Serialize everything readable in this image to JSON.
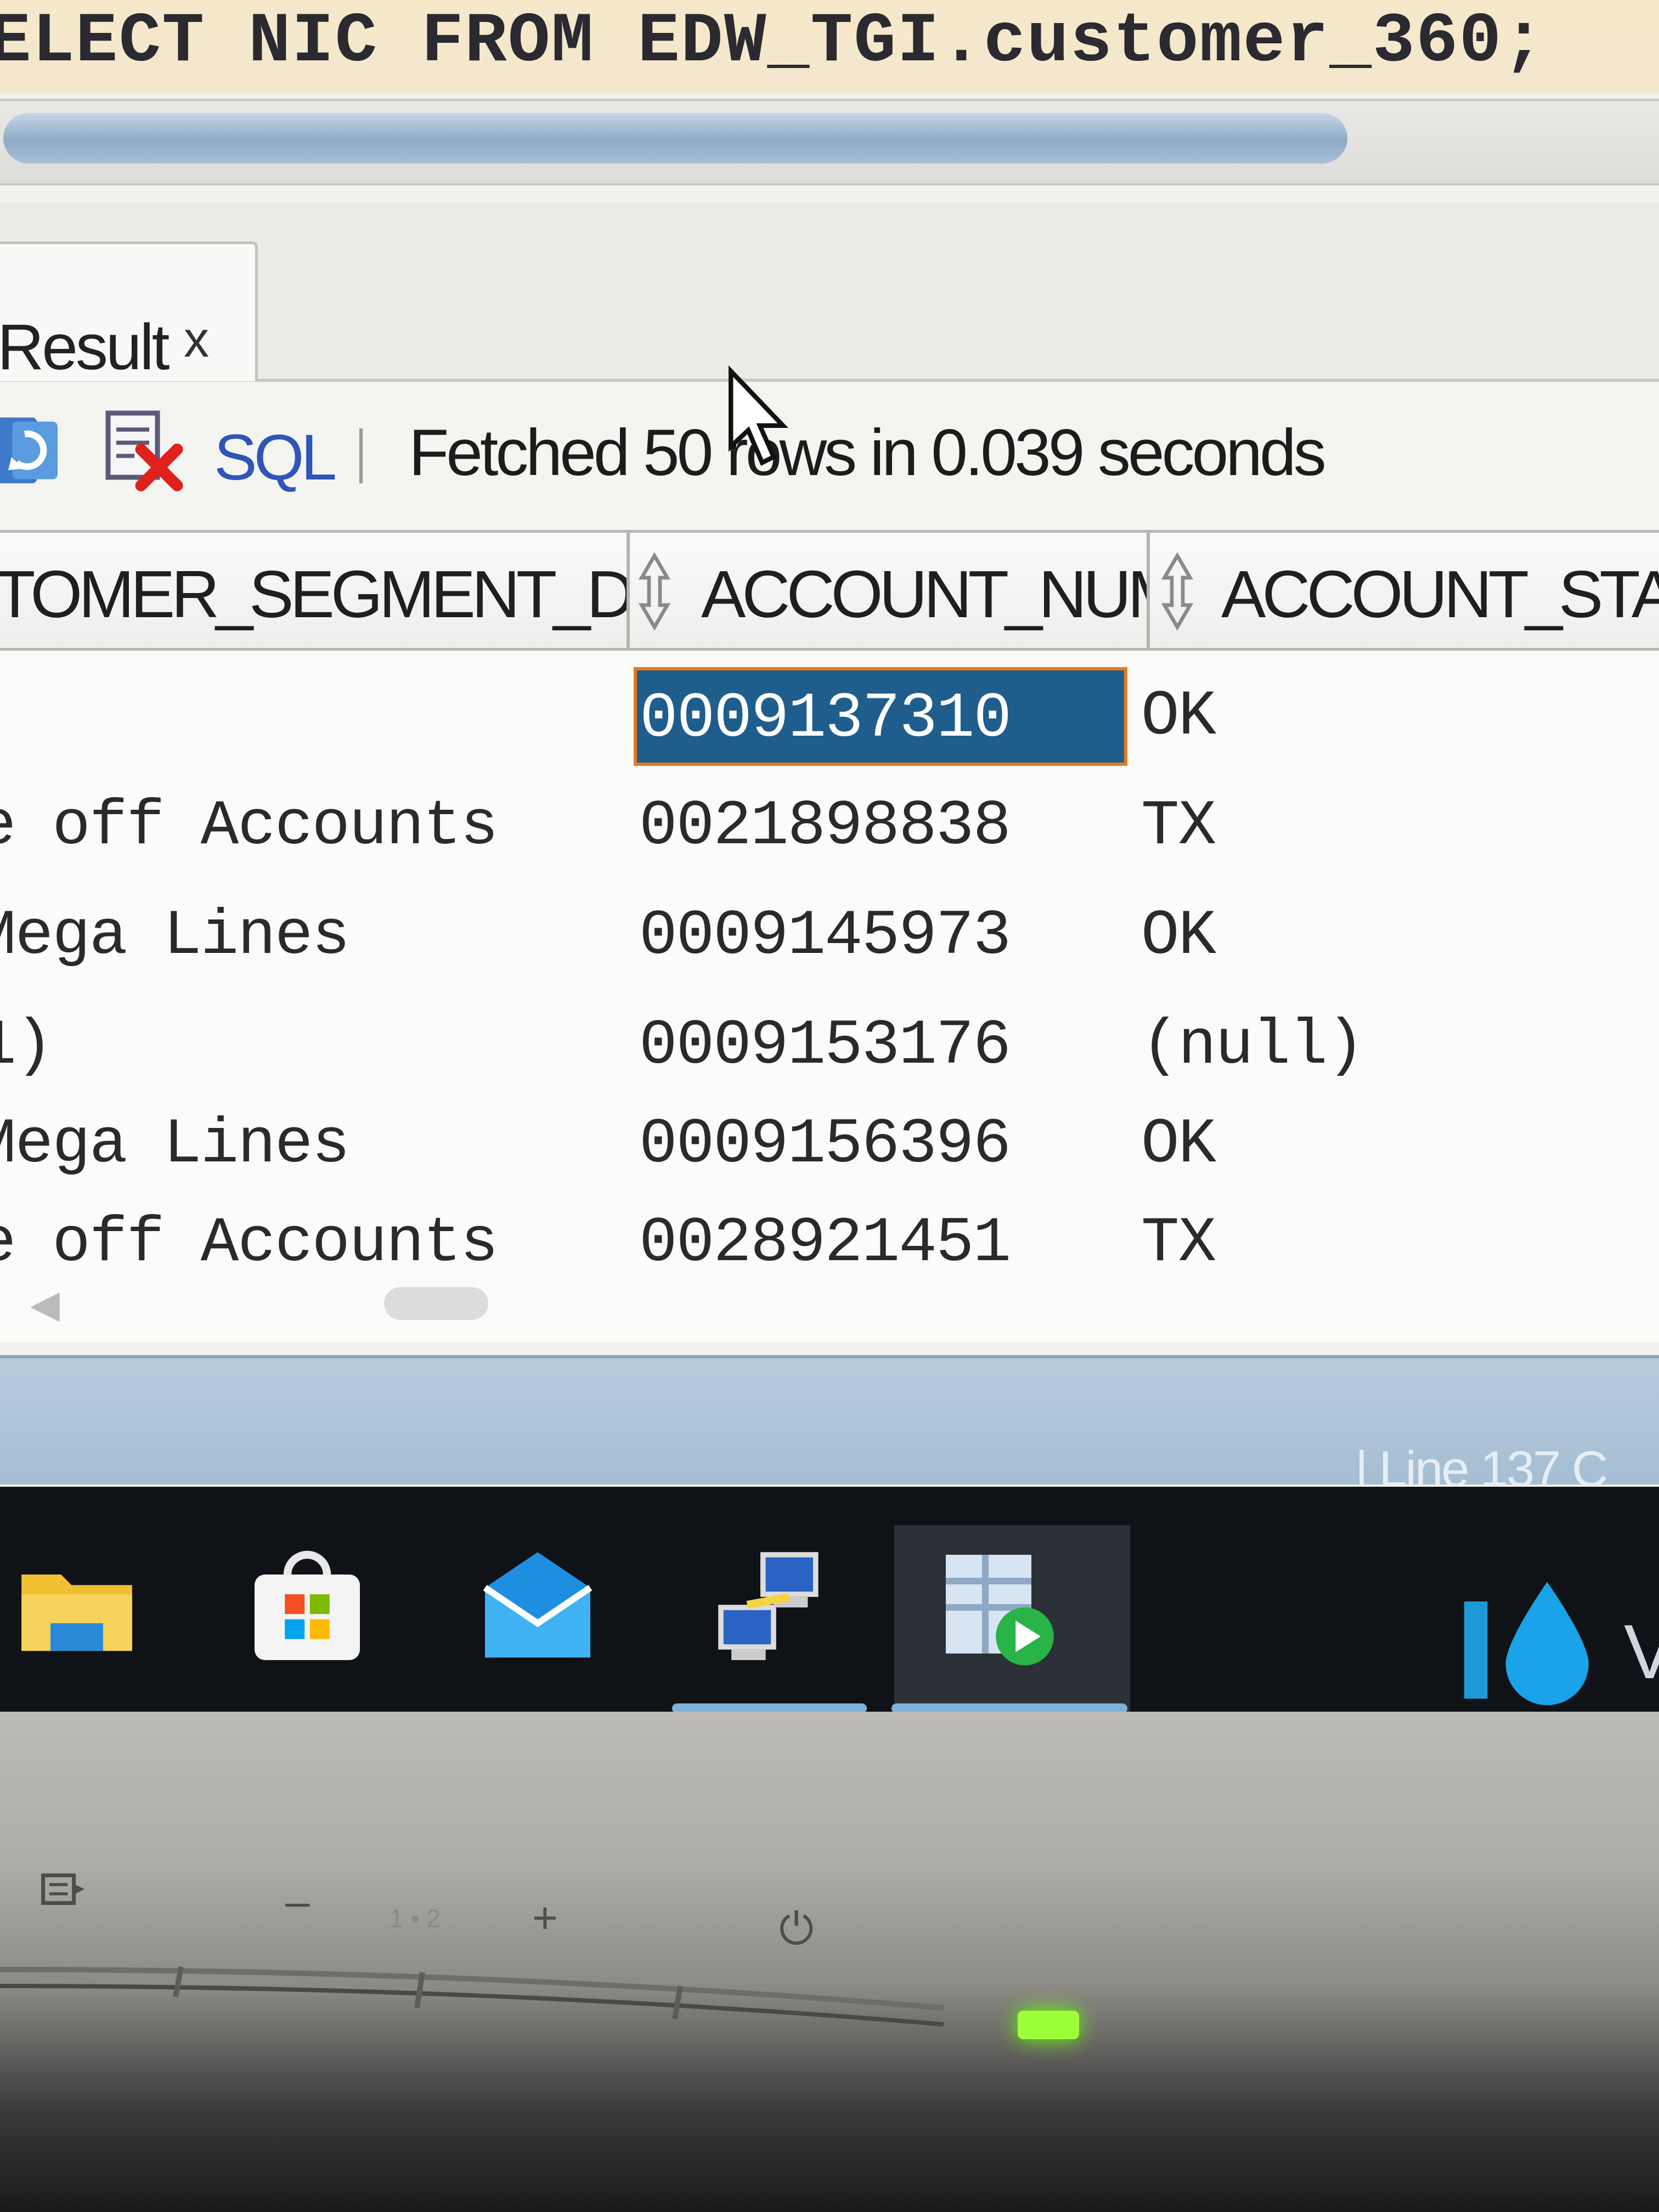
{
  "editor": {
    "sql_text": "ELECT NIC FROM EDW_TGI.customer_360;"
  },
  "tabs": {
    "result_label": "Result",
    "close_glyph": "x"
  },
  "toolbar": {
    "sql_label": "SQL",
    "fetch_status": "Fetched 50 rows in 0.039 seconds"
  },
  "grid": {
    "columns": [
      "TOMER_SEGMENT_DESC",
      "ACCOUNT_NUM",
      "ACCOUNT_STAT"
    ],
    "rows": [
      [
        "",
        "0009137310",
        "OK"
      ],
      [
        "e off  Accounts",
        "0021898838",
        "TX"
      ],
      [
        "Mega Lines",
        "0009145973",
        "OK"
      ],
      [
        "1)",
        "0009153176",
        "(null)"
      ],
      [
        "Mega Lines",
        "0009156396",
        "OK"
      ],
      [
        "e off  Accounts",
        "0028921451",
        "TX"
      ]
    ],
    "selected_cell": "0009137310"
  },
  "status_bar": {
    "line_text": "| Line 137 C"
  },
  "taskbar": {
    "apps": [
      "file-explorer-icon",
      "store-icon",
      "mail-icon",
      "network-icon",
      "sql-developer-icon"
    ],
    "active_app": "sql-developer-icon",
    "tray_text": "V"
  },
  "monitor": {
    "minus_label": "–",
    "input_label": "1 • 2",
    "plus_label": "+",
    "power_glyph": "⏻",
    "led_color": "#9cff3a"
  }
}
